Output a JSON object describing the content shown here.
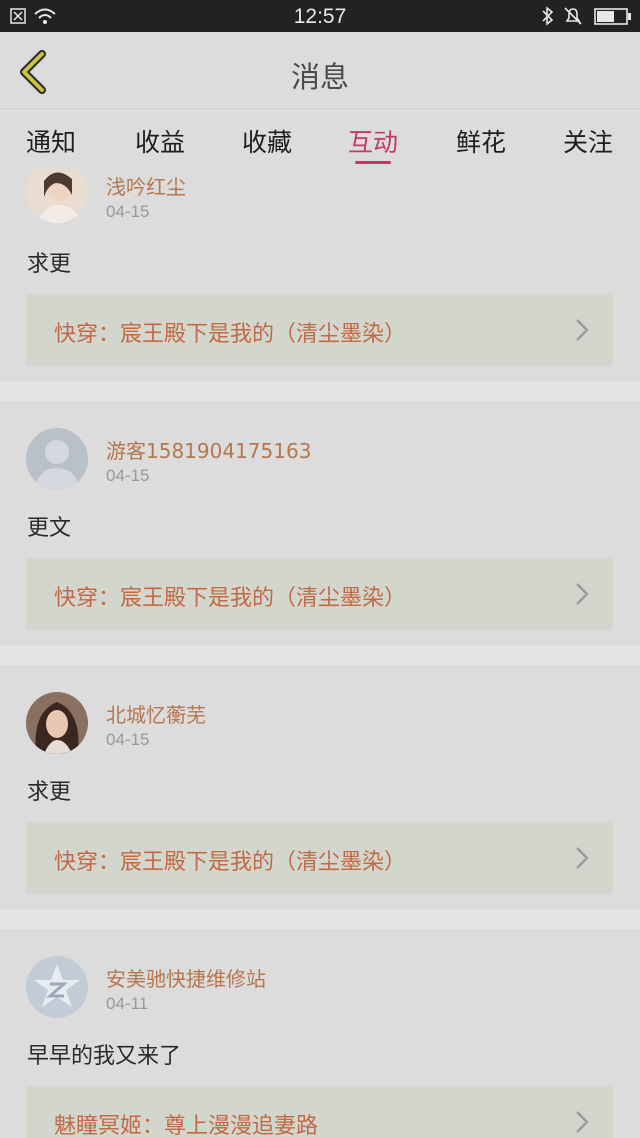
{
  "status_bar": {
    "time": "12:57",
    "icons": [
      "notification-icon",
      "wifi-icon",
      "bluetooth-icon",
      "mute-icon",
      "battery-icon"
    ]
  },
  "header": {
    "title": "消息",
    "back_icon": "chevron-left-icon",
    "accent_color": "#c9c23a"
  },
  "tabs": [
    {
      "label": "通知",
      "active": false
    },
    {
      "label": "收益",
      "active": false
    },
    {
      "label": "收藏",
      "active": false
    },
    {
      "label": "互动",
      "active": true
    },
    {
      "label": "鲜花",
      "active": false
    },
    {
      "label": "关注",
      "active": false
    }
  ],
  "colors": {
    "active_tab": "#c23a6a",
    "username": "#b4774f",
    "book_title": "#c26a45"
  },
  "messages": [
    {
      "username": "浅吟红尘",
      "date": "04-15",
      "comment": "求更",
      "book": "快穿：宸王殿下是我的（清尘墨染）",
      "avatar": "photo-avatar"
    },
    {
      "username": "游客1581904175163",
      "date": "04-15",
      "comment": "更文",
      "book": "快穿：宸王殿下是我的（清尘墨染）",
      "avatar": "default-user-avatar"
    },
    {
      "username": "北城忆蘅芜",
      "date": "04-15",
      "comment": "求更",
      "book": "快穿：宸王殿下是我的（清尘墨染）",
      "avatar": "photo-avatar"
    },
    {
      "username": "安美驰快捷维修站",
      "date": "04-11",
      "comment": "早早的我又来了",
      "book": "魅瞳冥姬：尊上漫漫追妻路",
      "avatar": "qq-logo-avatar"
    }
  ]
}
